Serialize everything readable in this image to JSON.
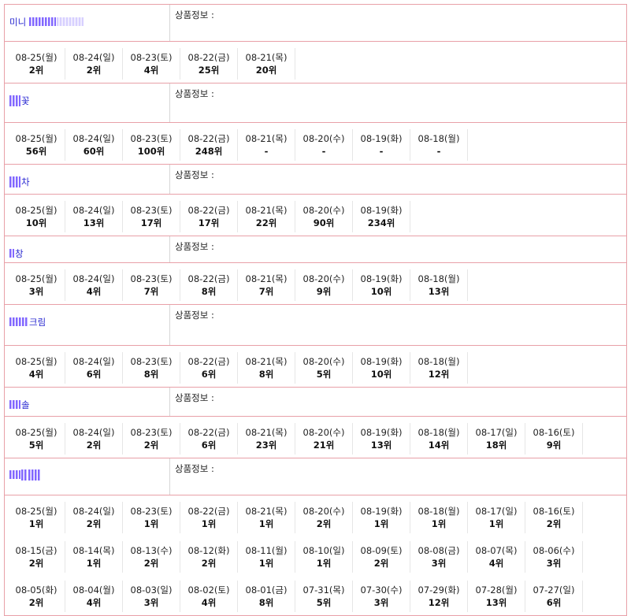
{
  "info_label": "상품정보 :",
  "products": [
    {
      "name_visible": "미니",
      "name_tail": "",
      "blur": "after",
      "head_h": 46,
      "rows": [
        [
          {
            "date": "08-25(월)",
            "rank": "2위"
          },
          {
            "date": "08-24(일)",
            "rank": "2위"
          },
          {
            "date": "08-23(토)",
            "rank": "4위"
          },
          {
            "date": "08-22(금)",
            "rank": "25위"
          },
          {
            "date": "08-21(목)",
            "rank": "20위"
          }
        ]
      ]
    },
    {
      "name_visible": "꽃",
      "blur": "before",
      "head_h": 49,
      "rows": [
        [
          {
            "date": "08-25(월)",
            "rank": "56위"
          },
          {
            "date": "08-24(일)",
            "rank": "60위"
          },
          {
            "date": "08-23(토)",
            "rank": "100위"
          },
          {
            "date": "08-22(금)",
            "rank": "248위"
          },
          {
            "date": "08-21(목)",
            "rank": "-"
          },
          {
            "date": "08-20(수)",
            "rank": "-"
          },
          {
            "date": "08-19(화)",
            "rank": "-"
          },
          {
            "date": "08-18(월)",
            "rank": "-"
          }
        ]
      ]
    },
    {
      "name_visible": "차",
      "blur": "before",
      "head_h": 37,
      "rows": [
        [
          {
            "date": "08-25(월)",
            "rank": "10위"
          },
          {
            "date": "08-24(일)",
            "rank": "13위"
          },
          {
            "date": "08-23(토)",
            "rank": "17위"
          },
          {
            "date": "08-22(금)",
            "rank": "17위"
          },
          {
            "date": "08-21(목)",
            "rank": "22위"
          },
          {
            "date": "08-20(수)",
            "rank": "90위"
          },
          {
            "date": "08-19(화)",
            "rank": "234위"
          }
        ]
      ]
    },
    {
      "name_visible": "창",
      "blur": "before",
      "head_h": 33,
      "rows": [
        [
          {
            "date": "08-25(월)",
            "rank": "3위"
          },
          {
            "date": "08-24(일)",
            "rank": "4위"
          },
          {
            "date": "08-23(토)",
            "rank": "7위"
          },
          {
            "date": "08-22(금)",
            "rank": "8위"
          },
          {
            "date": "08-21(목)",
            "rank": "7위"
          },
          {
            "date": "08-20(수)",
            "rank": "9위"
          },
          {
            "date": "08-19(화)",
            "rank": "10위"
          },
          {
            "date": "08-18(월)",
            "rank": "13위"
          }
        ]
      ]
    },
    {
      "name_visible": "크림",
      "blur": "before",
      "head_h": 51,
      "rows": [
        [
          {
            "date": "08-25(월)",
            "rank": "4위"
          },
          {
            "date": "08-24(일)",
            "rank": "6위"
          },
          {
            "date": "08-23(토)",
            "rank": "8위"
          },
          {
            "date": "08-22(금)",
            "rank": "6위"
          },
          {
            "date": "08-21(목)",
            "rank": "8위"
          },
          {
            "date": "08-20(수)",
            "rank": "5위"
          },
          {
            "date": "08-19(화)",
            "rank": "10위"
          },
          {
            "date": "08-18(월)",
            "rank": "12위"
          }
        ]
      ]
    },
    {
      "name_visible": "솔",
      "blur": "before",
      "head_h": 36,
      "rows": [
        [
          {
            "date": "08-25(월)",
            "rank": "5위"
          },
          {
            "date": "08-24(일)",
            "rank": "2위"
          },
          {
            "date": "08-23(토)",
            "rank": "2위"
          },
          {
            "date": "08-22(금)",
            "rank": "6위"
          },
          {
            "date": "08-21(목)",
            "rank": "23위"
          },
          {
            "date": "08-20(수)",
            "rank": "21위"
          },
          {
            "date": "08-19(화)",
            "rank": "13위"
          },
          {
            "date": "08-18(월)",
            "rank": "14위"
          },
          {
            "date": "08-17(일)",
            "rank": "18위"
          },
          {
            "date": "08-16(토)",
            "rank": "9위"
          }
        ]
      ]
    },
    {
      "name_visible": "",
      "blur": "only",
      "head_h": 46,
      "rows": [
        [
          {
            "date": "08-25(월)",
            "rank": "1위"
          },
          {
            "date": "08-24(일)",
            "rank": "2위"
          },
          {
            "date": "08-23(토)",
            "rank": "1위"
          },
          {
            "date": "08-22(금)",
            "rank": "1위"
          },
          {
            "date": "08-21(목)",
            "rank": "1위"
          },
          {
            "date": "08-20(수)",
            "rank": "2위"
          },
          {
            "date": "08-19(화)",
            "rank": "1위"
          },
          {
            "date": "08-18(월)",
            "rank": "1위"
          },
          {
            "date": "08-17(일)",
            "rank": "1위"
          },
          {
            "date": "08-16(토)",
            "rank": "2위"
          }
        ],
        [
          {
            "date": "08-15(금)",
            "rank": "2위"
          },
          {
            "date": "08-14(목)",
            "rank": "1위"
          },
          {
            "date": "08-13(수)",
            "rank": "2위"
          },
          {
            "date": "08-12(화)",
            "rank": "2위"
          },
          {
            "date": "08-11(월)",
            "rank": "1위"
          },
          {
            "date": "08-10(일)",
            "rank": "1위"
          },
          {
            "date": "08-09(토)",
            "rank": "2위"
          },
          {
            "date": "08-08(금)",
            "rank": "3위"
          },
          {
            "date": "08-07(목)",
            "rank": "4위"
          },
          {
            "date": "08-06(수)",
            "rank": "3위"
          }
        ],
        [
          {
            "date": "08-05(화)",
            "rank": "2위"
          },
          {
            "date": "08-04(월)",
            "rank": "4위"
          },
          {
            "date": "08-03(일)",
            "rank": "3위"
          },
          {
            "date": "08-02(토)",
            "rank": "4위"
          },
          {
            "date": "08-01(금)",
            "rank": "8위"
          },
          {
            "date": "07-31(목)",
            "rank": "5위"
          },
          {
            "date": "07-30(수)",
            "rank": "3위"
          },
          {
            "date": "07-29(화)",
            "rank": "12위"
          },
          {
            "date": "07-28(월)",
            "rank": "13위"
          },
          {
            "date": "07-27(일)",
            "rank": "6위"
          }
        ]
      ]
    }
  ]
}
